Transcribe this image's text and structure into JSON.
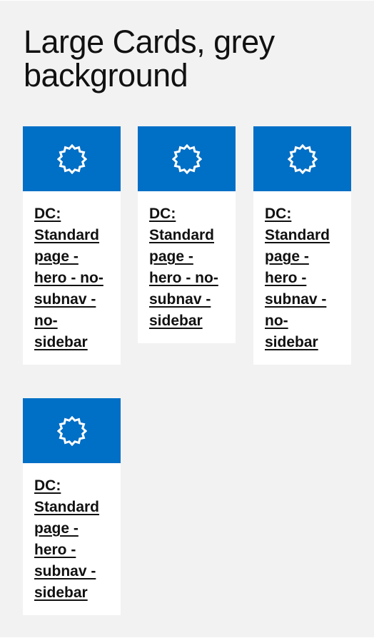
{
  "page": {
    "title": "Large Cards, grey background"
  },
  "colors": {
    "background": "#f2f2f2",
    "card_hero": "#006fc6",
    "card_body": "#ffffff",
    "text": "#111111"
  },
  "cards": [
    {
      "icon": "starburst-icon",
      "title": "DC: Standard page - hero - no-subnav - no-sidebar"
    },
    {
      "icon": "starburst-icon",
      "title": "DC: Standard page - hero - no-subnav - sidebar"
    },
    {
      "icon": "starburst-icon",
      "title": "DC: Standard page - hero - subnav - no-sidebar"
    },
    {
      "icon": "starburst-icon",
      "title": "DC: Standard page - hero - subnav - sidebar"
    }
  ]
}
